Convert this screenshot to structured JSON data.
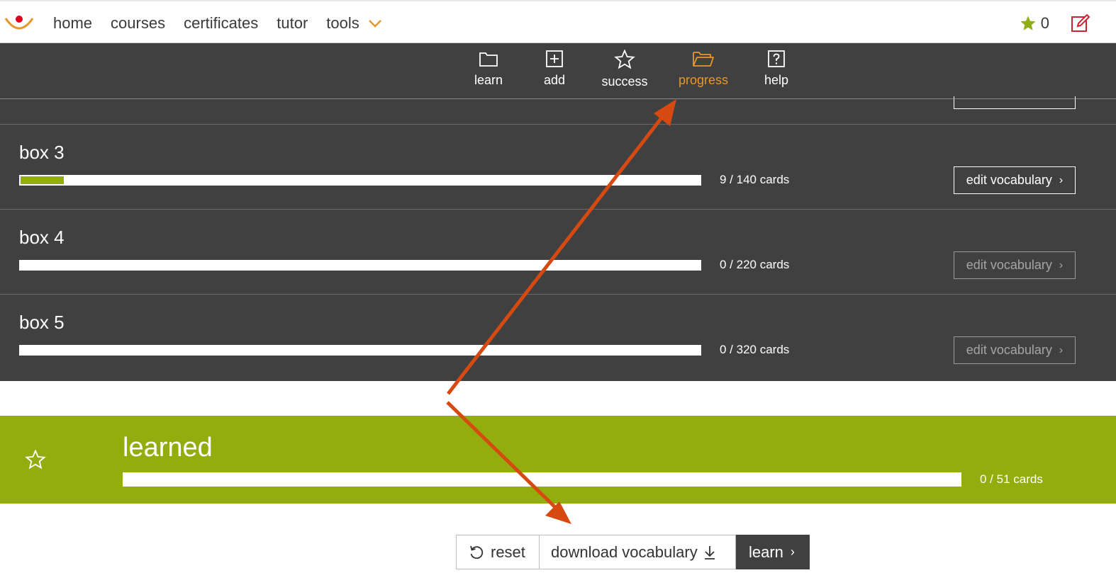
{
  "topnav": {
    "links": [
      "home",
      "courses",
      "certificates",
      "tutor",
      "tools"
    ],
    "star_count": "0",
    "colors": {
      "logo_red": "#e2001a",
      "logo_orange": "#e8962a",
      "star_green": "#8fad15",
      "edit_red": "#cc2233"
    }
  },
  "subnav": {
    "items": [
      {
        "label": "learn",
        "icon": "folder-icon"
      },
      {
        "label": "add",
        "icon": "plus-square-icon"
      },
      {
        "label": "success",
        "icon": "star-outline-icon"
      },
      {
        "label": "progress",
        "icon": "folder-open-icon",
        "active": true
      },
      {
        "label": "help",
        "icon": "question-square-icon"
      }
    ],
    "active_color": "#e8962a"
  },
  "boxes": [
    {
      "title": "box 3",
      "count": "9 / 140 cards",
      "progress": 0.064,
      "edit_label": "edit vocabulary",
      "edit_enabled": true
    },
    {
      "title": "box 4",
      "count": "0 / 220 cards",
      "progress": 0,
      "edit_label": "edit vocabulary",
      "edit_enabled": false
    },
    {
      "title": "box 5",
      "count": "0 / 320 cards",
      "progress": 0,
      "edit_label": "edit vocabulary",
      "edit_enabled": false
    }
  ],
  "learned": {
    "title": "learned",
    "count": "0 / 51 cards",
    "progress": 0,
    "color": "#93ad0f"
  },
  "actions": {
    "reset_label": "reset",
    "download_label": "download vocabulary",
    "learn_label": "learn"
  },
  "annotation_color": "#d64a12"
}
